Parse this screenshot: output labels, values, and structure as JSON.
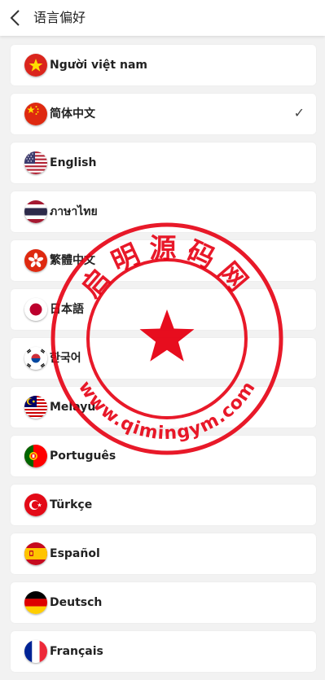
{
  "header": {
    "title": "语言偏好"
  },
  "languages": [
    {
      "label": "Người việt nam",
      "flag": "vietnam-flag-icon",
      "selected": false
    },
    {
      "label": "简体中文",
      "flag": "china-flag-icon",
      "selected": true
    },
    {
      "label": "English",
      "flag": "usa-flag-icon",
      "selected": false
    },
    {
      "label": "ภาษาไทย",
      "flag": "thailand-flag-icon",
      "selected": false
    },
    {
      "label": "繁體中文",
      "flag": "hong-kong-flag-icon",
      "selected": false
    },
    {
      "label": "日本語",
      "flag": "japan-flag-icon",
      "selected": false
    },
    {
      "label": "한국어",
      "flag": "korea-flag-icon",
      "selected": false
    },
    {
      "label": "Melayu",
      "flag": "malaysia-flag-icon",
      "selected": false
    },
    {
      "label": "Português",
      "flag": "portugal-flag-icon",
      "selected": false
    },
    {
      "label": "Türkçe",
      "flag": "turkey-flag-icon",
      "selected": false
    },
    {
      "label": "Español",
      "flag": "spain-flag-icon",
      "selected": false
    },
    {
      "label": "Deutsch",
      "flag": "germany-flag-icon",
      "selected": false
    },
    {
      "label": "Français",
      "flag": "france-flag-icon",
      "selected": false
    }
  ],
  "check_mark": "✓",
  "watermark": {
    "top_text": "启明源码网",
    "bottom_text": "www.qimingym.com",
    "color": "#e60012"
  },
  "colors": {
    "background": "#f2f2f2",
    "card": "#ffffff",
    "text": "#222222"
  }
}
